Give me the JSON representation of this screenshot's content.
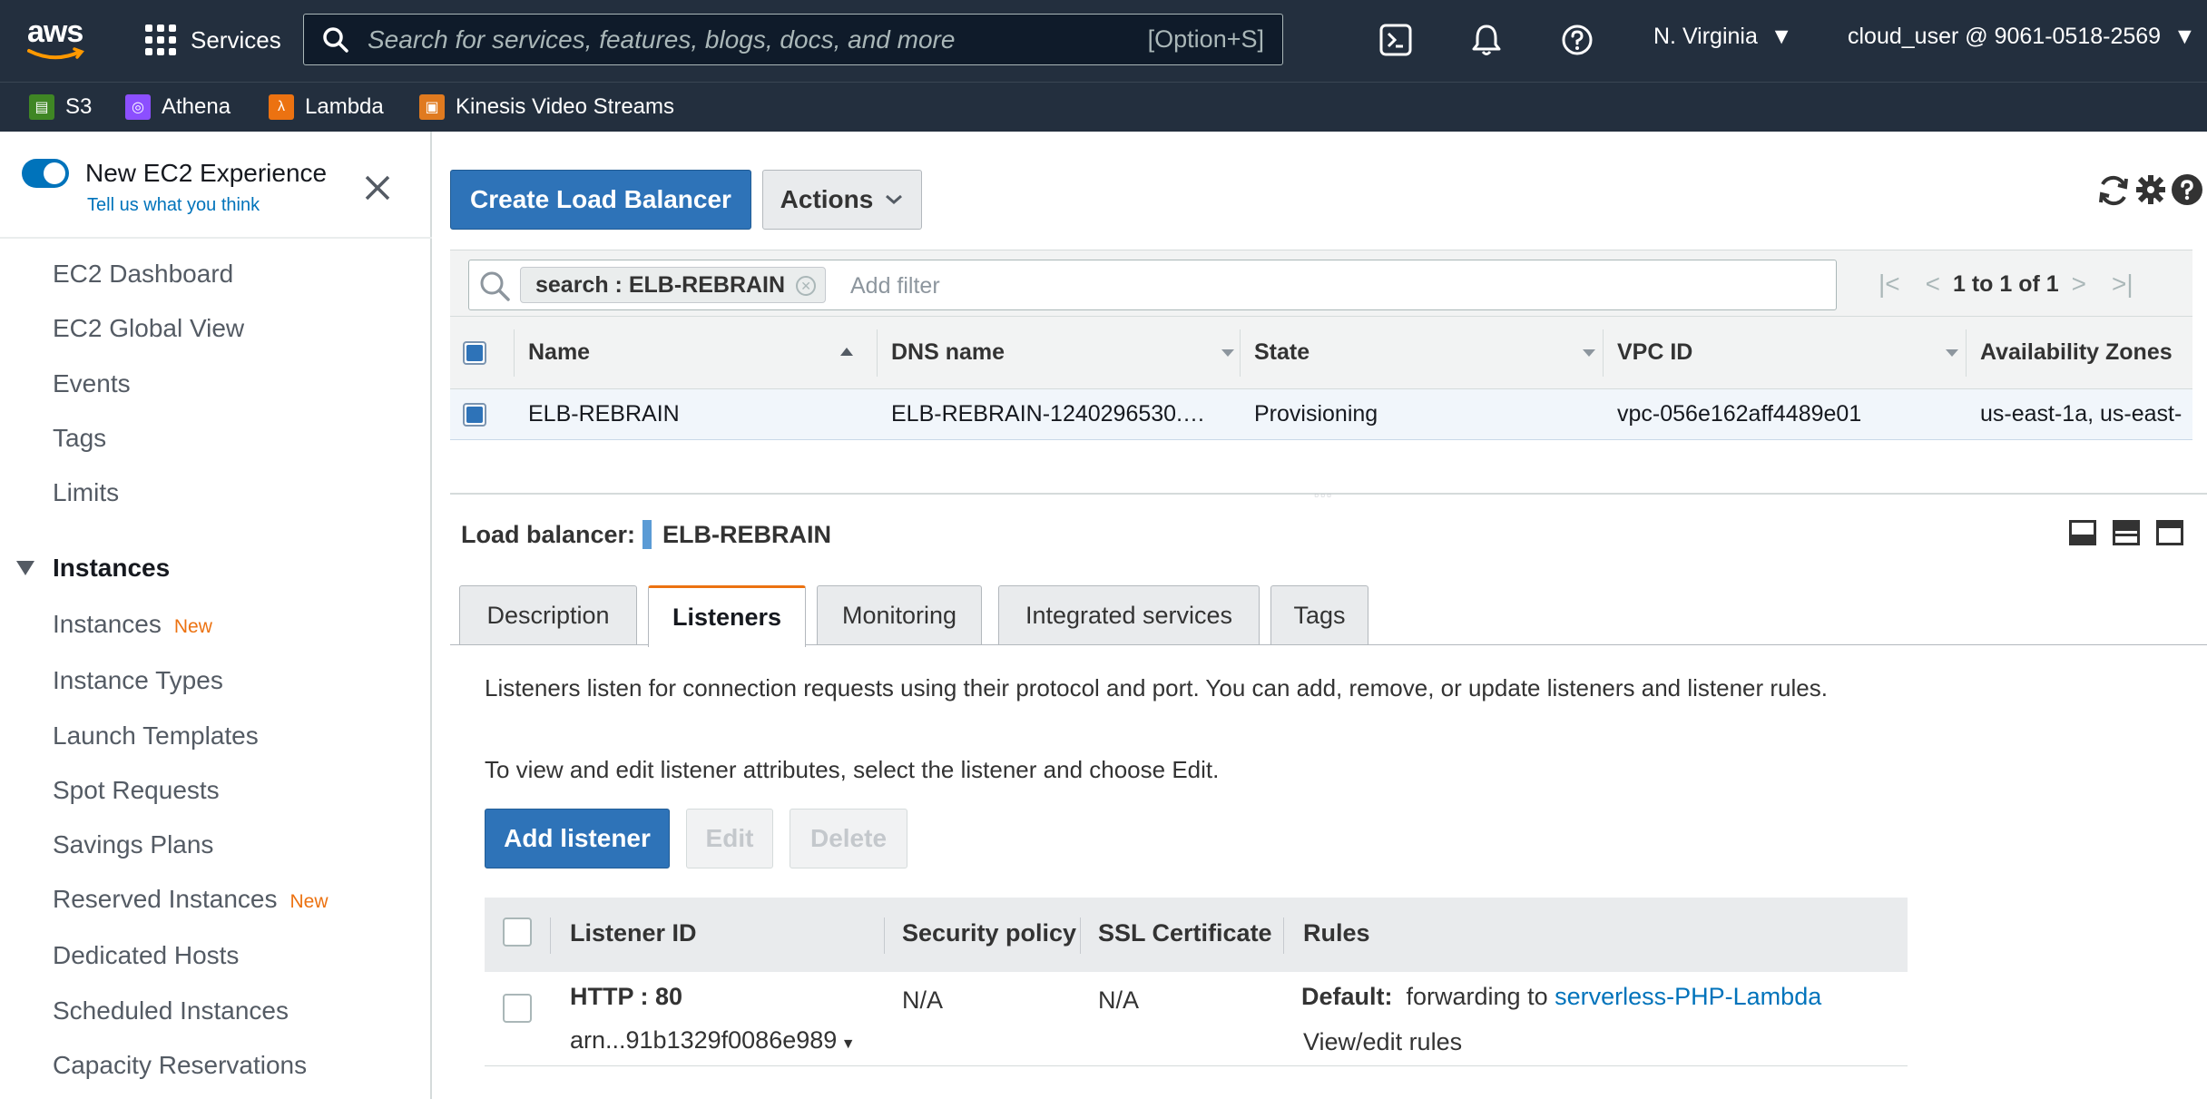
{
  "topnav": {
    "logo_text": "aws",
    "services_label": "Services",
    "search_placeholder": "Search for services, features, blogs, docs, and more",
    "search_shortcut": "[Option+S]",
    "region": "N. Virginia",
    "account": "cloud_user @ 9061-0518-2569"
  },
  "favorites": [
    {
      "label": "S3",
      "color": "#3f8624"
    },
    {
      "label": "Athena",
      "color": "#8c4fff"
    },
    {
      "label": "Lambda",
      "color": "#ec7211"
    },
    {
      "label": "Kinesis Video Streams",
      "color": "#e07a1f"
    }
  ],
  "sidebar": {
    "toggle_label": "New EC2 Experience",
    "feedback_link": "Tell us what you think",
    "top_items": [
      "EC2 Dashboard",
      "EC2 Global View",
      "Events",
      "Tags",
      "Limits"
    ],
    "section_label": "Instances",
    "section_items": [
      {
        "label": "Instances",
        "badge": "New"
      },
      {
        "label": "Instance Types",
        "badge": ""
      },
      {
        "label": "Launch Templates",
        "badge": ""
      },
      {
        "label": "Spot Requests",
        "badge": ""
      },
      {
        "label": "Savings Plans",
        "badge": ""
      },
      {
        "label": "Reserved Instances",
        "badge": "New"
      },
      {
        "label": "Dedicated Hosts",
        "badge": ""
      },
      {
        "label": "Scheduled Instances",
        "badge": ""
      },
      {
        "label": "Capacity Reservations",
        "badge": ""
      }
    ]
  },
  "toolbar": {
    "create_label": "Create Load Balancer",
    "actions_label": "Actions"
  },
  "filter": {
    "chip_label": "search : ELB-REBRAIN",
    "add_filter_placeholder": "Add filter",
    "pagination": "1 to 1 of 1"
  },
  "grid": {
    "columns": [
      "Name",
      "DNS name",
      "State",
      "VPC ID",
      "Availability Zones"
    ],
    "rows": [
      {
        "name": "ELB-REBRAIN",
        "dns": "ELB-REBRAIN-1240296530.…",
        "state": "Provisioning",
        "vpc": "vpc-056e162aff4489e01",
        "az": "us-east-1a, us-east-"
      }
    ]
  },
  "detail": {
    "title_label": "Load balancer:",
    "title_value": "ELB-REBRAIN",
    "tabs": [
      "Description",
      "Listeners",
      "Monitoring",
      "Integrated services",
      "Tags"
    ],
    "active_tab": "Listeners",
    "intro_text": "Listeners listen for connection requests using their protocol and port. You can add, remove, or update listeners and listener rules.",
    "edit_hint": "To view and edit listener attributes, select the listener and choose Edit.",
    "buttons": {
      "add": "Add listener",
      "edit": "Edit",
      "delete": "Delete"
    }
  },
  "listeners": {
    "columns": [
      "Listener ID",
      "Security policy",
      "SSL Certificate",
      "Rules"
    ],
    "rows": [
      {
        "id": "HTTP : 80",
        "arn": "arn...91b1329f0086e989",
        "security_policy": "N/A",
        "ssl_certificate": "N/A",
        "rule_label": "Default:",
        "rule_text": "forwarding to",
        "rule_target": "serverless-PHP-Lambda",
        "rule_link": "View/edit rules"
      }
    ]
  },
  "colors": {
    "nav_bg": "#232f3e",
    "primary": "#2e73b8",
    "link": "#0073bb",
    "accent_orange": "#ec7211"
  }
}
